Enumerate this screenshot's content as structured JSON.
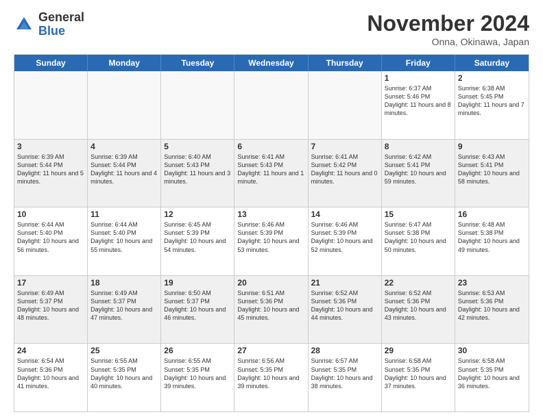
{
  "logo": {
    "general": "General",
    "blue": "Blue"
  },
  "header": {
    "month": "November 2024",
    "location": "Onna, Okinawa, Japan"
  },
  "days": [
    "Sunday",
    "Monday",
    "Tuesday",
    "Wednesday",
    "Thursday",
    "Friday",
    "Saturday"
  ],
  "rows": [
    [
      {
        "num": "",
        "text": "",
        "empty": true
      },
      {
        "num": "",
        "text": "",
        "empty": true
      },
      {
        "num": "",
        "text": "",
        "empty": true
      },
      {
        "num": "",
        "text": "",
        "empty": true
      },
      {
        "num": "",
        "text": "",
        "empty": true
      },
      {
        "num": "1",
        "text": "Sunrise: 6:37 AM\nSunset: 5:46 PM\nDaylight: 11 hours\nand 8 minutes."
      },
      {
        "num": "2",
        "text": "Sunrise: 6:38 AM\nSunset: 5:45 PM\nDaylight: 11 hours\nand 7 minutes."
      }
    ],
    [
      {
        "num": "3",
        "text": "Sunrise: 6:39 AM\nSunset: 5:44 PM\nDaylight: 11 hours\nand 5 minutes."
      },
      {
        "num": "4",
        "text": "Sunrise: 6:39 AM\nSunset: 5:44 PM\nDaylight: 11 hours\nand 4 minutes."
      },
      {
        "num": "5",
        "text": "Sunrise: 6:40 AM\nSunset: 5:43 PM\nDaylight: 11 hours\nand 3 minutes."
      },
      {
        "num": "6",
        "text": "Sunrise: 6:41 AM\nSunset: 5:43 PM\nDaylight: 11 hours\nand 1 minute."
      },
      {
        "num": "7",
        "text": "Sunrise: 6:41 AM\nSunset: 5:42 PM\nDaylight: 11 hours\nand 0 minutes."
      },
      {
        "num": "8",
        "text": "Sunrise: 6:42 AM\nSunset: 5:41 PM\nDaylight: 10 hours\nand 59 minutes."
      },
      {
        "num": "9",
        "text": "Sunrise: 6:43 AM\nSunset: 5:41 PM\nDaylight: 10 hours\nand 58 minutes."
      }
    ],
    [
      {
        "num": "10",
        "text": "Sunrise: 6:44 AM\nSunset: 5:40 PM\nDaylight: 10 hours\nand 56 minutes."
      },
      {
        "num": "11",
        "text": "Sunrise: 6:44 AM\nSunset: 5:40 PM\nDaylight: 10 hours\nand 55 minutes."
      },
      {
        "num": "12",
        "text": "Sunrise: 6:45 AM\nSunset: 5:39 PM\nDaylight: 10 hours\nand 54 minutes."
      },
      {
        "num": "13",
        "text": "Sunrise: 6:46 AM\nSunset: 5:39 PM\nDaylight: 10 hours\nand 53 minutes."
      },
      {
        "num": "14",
        "text": "Sunrise: 6:46 AM\nSunset: 5:39 PM\nDaylight: 10 hours\nand 52 minutes."
      },
      {
        "num": "15",
        "text": "Sunrise: 6:47 AM\nSunset: 5:38 PM\nDaylight: 10 hours\nand 50 minutes."
      },
      {
        "num": "16",
        "text": "Sunrise: 6:48 AM\nSunset: 5:38 PM\nDaylight: 10 hours\nand 49 minutes."
      }
    ],
    [
      {
        "num": "17",
        "text": "Sunrise: 6:49 AM\nSunset: 5:37 PM\nDaylight: 10 hours\nand 48 minutes."
      },
      {
        "num": "18",
        "text": "Sunrise: 6:49 AM\nSunset: 5:37 PM\nDaylight: 10 hours\nand 47 minutes."
      },
      {
        "num": "19",
        "text": "Sunrise: 6:50 AM\nSunset: 5:37 PM\nDaylight: 10 hours\nand 46 minutes."
      },
      {
        "num": "20",
        "text": "Sunrise: 6:51 AM\nSunset: 5:36 PM\nDaylight: 10 hours\nand 45 minutes."
      },
      {
        "num": "21",
        "text": "Sunrise: 6:52 AM\nSunset: 5:36 PM\nDaylight: 10 hours\nand 44 minutes."
      },
      {
        "num": "22",
        "text": "Sunrise: 6:52 AM\nSunset: 5:36 PM\nDaylight: 10 hours\nand 43 minutes."
      },
      {
        "num": "23",
        "text": "Sunrise: 6:53 AM\nSunset: 5:36 PM\nDaylight: 10 hours\nand 42 minutes."
      }
    ],
    [
      {
        "num": "24",
        "text": "Sunrise: 6:54 AM\nSunset: 5:36 PM\nDaylight: 10 hours\nand 41 minutes."
      },
      {
        "num": "25",
        "text": "Sunrise: 6:55 AM\nSunset: 5:35 PM\nDaylight: 10 hours\nand 40 minutes."
      },
      {
        "num": "26",
        "text": "Sunrise: 6:55 AM\nSunset: 5:35 PM\nDaylight: 10 hours\nand 39 minutes."
      },
      {
        "num": "27",
        "text": "Sunrise: 6:56 AM\nSunset: 5:35 PM\nDaylight: 10 hours\nand 39 minutes."
      },
      {
        "num": "28",
        "text": "Sunrise: 6:57 AM\nSunset: 5:35 PM\nDaylight: 10 hours\nand 38 minutes."
      },
      {
        "num": "29",
        "text": "Sunrise: 6:58 AM\nSunset: 5:35 PM\nDaylight: 10 hours\nand 37 minutes."
      },
      {
        "num": "30",
        "text": "Sunrise: 6:58 AM\nSunset: 5:35 PM\nDaylight: 10 hours\nand 36 minutes."
      }
    ]
  ]
}
